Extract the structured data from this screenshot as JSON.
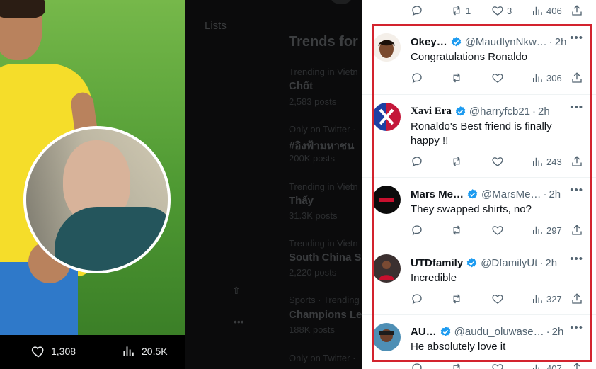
{
  "media": {
    "likes": "1,308",
    "views": "20.5K"
  },
  "sidebar": {
    "lists_label": "Lists",
    "trends_title": "Trends for",
    "trends": [
      {
        "label": "Trending in Vietn",
        "title": "Chốt",
        "count": "2,583 posts"
      },
      {
        "label": "Only on Twitter ·",
        "title": "#อิงฟ้ามหาชน",
        "count": "200K posts"
      },
      {
        "label": "Trending in Vietn",
        "title": "Thấy",
        "count": "31.3K posts"
      },
      {
        "label": "Trending in Vietn",
        "title": "South China Se",
        "count": "2,220 posts"
      },
      {
        "label": "Sports · Trending",
        "title": "Champions Lea",
        "count": "188K posts"
      },
      {
        "label": "Only on Twitter ·",
        "title": "",
        "count": ""
      }
    ]
  },
  "top_tweet_actions": {
    "reposts": "1",
    "likes": "3",
    "views": "406"
  },
  "replies": [
    {
      "name": "Okey…",
      "handle": "@MaudlynNkw…",
      "time": "2h",
      "text": "Congratulations Ronaldo",
      "views": "306",
      "avatar_color": "#f4efe9"
    },
    {
      "name": "Xavi Era",
      "handle": "@harryfcb21",
      "time": "2h",
      "text": "Ronaldo's Best friend is finally happy !!",
      "views": "243",
      "avatar_color": "#1d3fa3"
    },
    {
      "name": "Mars Me…",
      "handle": "@MarsMe…",
      "time": "2h",
      "text": "They swapped shirts, no?",
      "views": "297",
      "avatar_color": "#0b0b0b"
    },
    {
      "name": "UTDfamily",
      "handle": "@DfamilyUt",
      "time": "2h",
      "text": "Incredible",
      "views": "327",
      "avatar_color": "#3b3030"
    },
    {
      "name": "AU…",
      "handle": "@audu_oluwase…",
      "time": "2h",
      "text": "He absolutely love it",
      "views": "407",
      "avatar_color": "#4e8fb5"
    }
  ],
  "colors": {
    "verified": "#1d9bf0",
    "action_gray": "#536471",
    "highlight": "#d3232e"
  },
  "icons": [
    "reply-icon",
    "repost-icon",
    "like-icon",
    "views-icon",
    "share-icon",
    "verified-icon",
    "more-icon"
  ]
}
